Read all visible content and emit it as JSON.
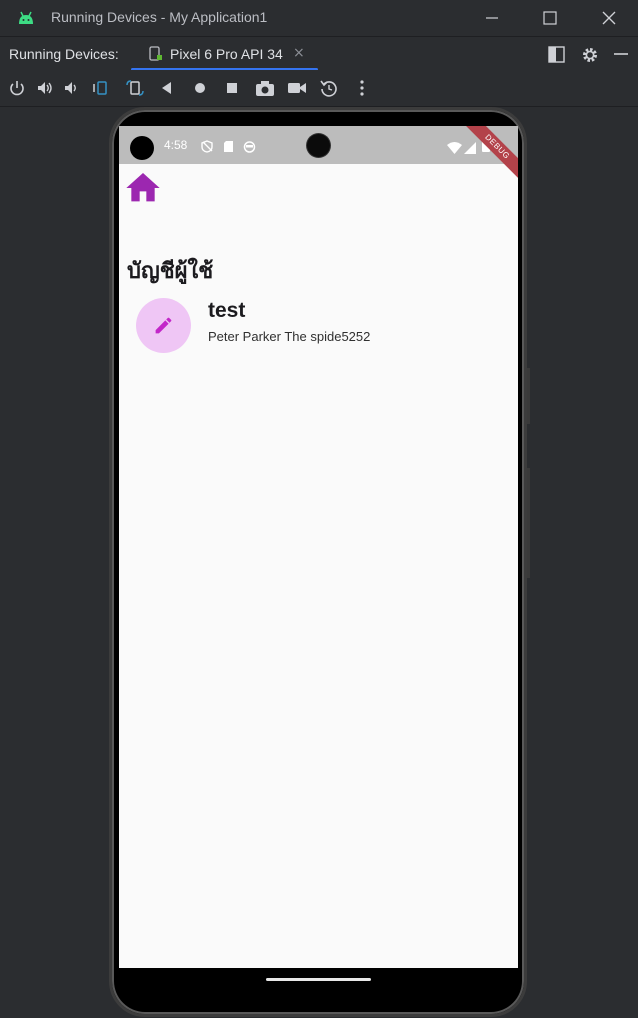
{
  "window": {
    "title": "Running Devices - My Application1"
  },
  "tabbar": {
    "label": "Running Devices:",
    "device_tab": "Pixel 6 Pro API 34",
    "close_glyph": "×"
  },
  "toolbar": {
    "icons": [
      "power-icon",
      "volume-up-icon",
      "volume-down-icon",
      "rotate-left-icon",
      "rotate-right-icon",
      "back-icon",
      "home-icon",
      "overview-icon",
      "screenshot-icon",
      "screen-record-icon",
      "snapshot-icon",
      "more-icon"
    ]
  },
  "device": {
    "status": {
      "time": "4:58",
      "debug_label": "DEBUG"
    },
    "page": {
      "title": "บัญชีผู้ใช้",
      "items": [
        {
          "title": "test",
          "subtitle": "Peter Parker The spide5252"
        }
      ]
    }
  },
  "colors": {
    "accent": "#9c27b0",
    "avatar_bg": "#efc6f5",
    "ide_bg": "#2b2d30",
    "tab_underline": "#3574f0",
    "debug_ribbon": "#b3424a"
  }
}
